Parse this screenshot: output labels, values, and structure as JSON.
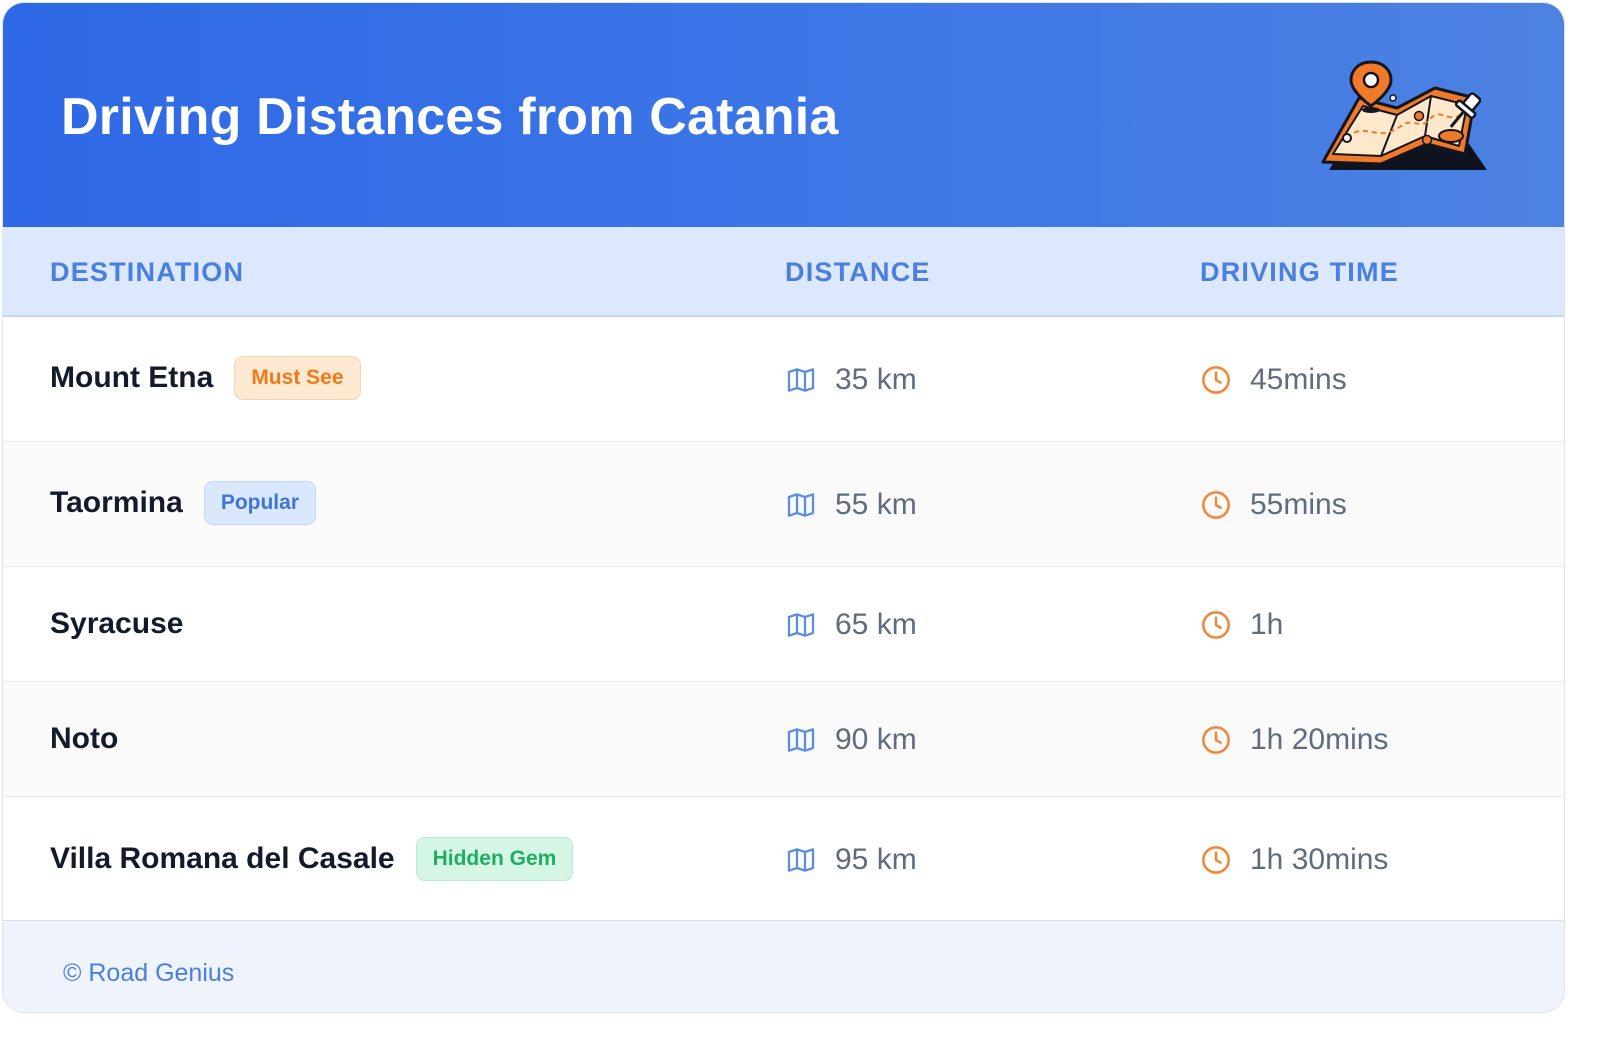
{
  "title": "Driving Distances from Catania",
  "illustration_icon": "map-with-pin-icon",
  "columns": {
    "destination": "DESTINATION",
    "distance": "DISTANCE",
    "driving_time": "DRIVING TIME"
  },
  "rows": [
    {
      "destination": "Mount Etna",
      "badge": "Must See",
      "badge_color": "#f07a1a",
      "distance": "35 km",
      "time": "45mins"
    },
    {
      "destination": "Taormina",
      "badge": "Popular",
      "badge_color": "#3f74d9",
      "distance": "55 km",
      "time": "55mins"
    },
    {
      "destination": "Syracuse",
      "badge": "",
      "distance": "65 km",
      "time": "1h"
    },
    {
      "destination": "Noto",
      "badge": "",
      "distance": "90 km",
      "time": "1h 20mins"
    },
    {
      "destination": "Villa Romana del Casale",
      "badge": "Hidden Gem",
      "badge_color": "#1cae63",
      "distance": "95 km",
      "time": "1h 30mins"
    }
  ],
  "icons": {
    "distance": "map-icon",
    "time": "clock-icon"
  },
  "colors": {
    "header_gradient_start": "#2e68e6",
    "header_gradient_end": "#4d82e2",
    "accent_blue": "#4a7ee0",
    "accent_orange": "#f07a1a"
  },
  "footer": {
    "copyright": "© Road Genius"
  }
}
